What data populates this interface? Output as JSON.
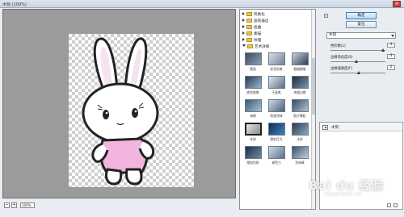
{
  "window": {
    "title": "木刻 (100%)"
  },
  "zoom": {
    "value": "100%",
    "minus": "−",
    "plus": "+"
  },
  "gallery": {
    "categories": [
      {
        "label": "风格化",
        "expanded": false
      },
      {
        "label": "画笔描边",
        "expanded": false
      },
      {
        "label": "扭曲",
        "expanded": false
      },
      {
        "label": "素描",
        "expanded": false
      },
      {
        "label": "纹理",
        "expanded": false
      },
      {
        "label": "艺术效果",
        "expanded": true
      }
    ],
    "filters": [
      {
        "label": "壁画"
      },
      {
        "label": "彩色铅笔"
      },
      {
        "label": "粗糙蜡笔"
      },
      {
        "label": "底纹效果"
      },
      {
        "label": "干画笔"
      },
      {
        "label": "海报边缘"
      },
      {
        "label": "海绵"
      },
      {
        "label": "绘画涂抹"
      },
      {
        "label": "胶片颗粒"
      },
      {
        "label": "木刻",
        "selected": true
      },
      {
        "label": "霓虹灯光"
      },
      {
        "label": "水彩"
      },
      {
        "label": "塑料包装"
      },
      {
        "label": "调色刀"
      },
      {
        "label": "涂抹棒"
      }
    ]
  },
  "options": {
    "ok_label": "确定",
    "reset_label": "复位",
    "selected_filter": "木刻",
    "params": [
      {
        "label": "色阶数(L)",
        "value": "4",
        "fraction": 0.95
      },
      {
        "label": "边缘简化度(S)",
        "value": "4",
        "fraction": 0.45
      },
      {
        "label": "边缘逼真度(F)",
        "value": "2",
        "fraction": 0.5
      }
    ]
  },
  "layers": {
    "item_label": "木刻"
  },
  "watermark": {
    "text": "Bai du 经验",
    "sub": "jingyan.baidu.com"
  },
  "colors": {
    "preview_bg": "#9b9b9b",
    "pink_dress": "#f2b6de",
    "close_red": "#c7463a"
  }
}
